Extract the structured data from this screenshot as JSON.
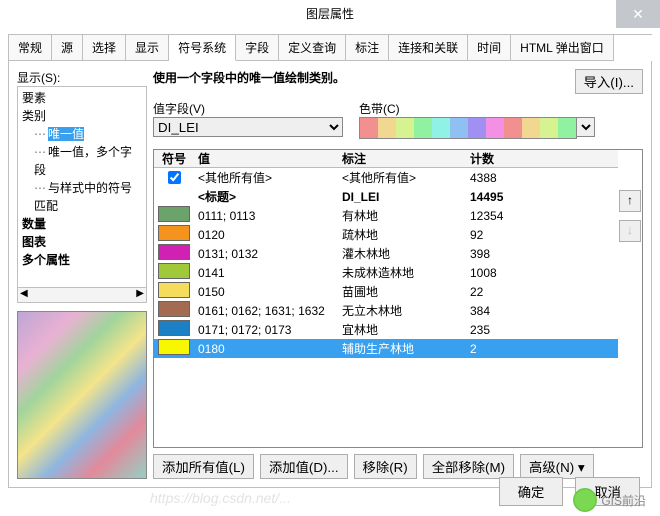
{
  "title": "图层属性",
  "tabs": [
    "常规",
    "源",
    "选择",
    "显示",
    "符号系统",
    "字段",
    "定义查询",
    "标注",
    "连接和关联",
    "时间",
    "HTML 弹出窗口"
  ],
  "active_tab": 4,
  "left": {
    "show_label": "显示(S):",
    "items": {
      "l0": "要素",
      "l1": "类别",
      "l2": "唯一值",
      "l3": "唯一值，多个字段",
      "l4": "与样式中的符号匹配",
      "l5": "数量",
      "l6": "图表",
      "l7": "多个属性"
    },
    "scroll_left": "◀",
    "scroll_right": "▶"
  },
  "right": {
    "desc": "使用一个字段中的唯一值绘制类别。",
    "import": "导入(I)...",
    "value_field_label": "值字段(V)",
    "value_field": "DI_LEI",
    "ramp_label": "色带(C)",
    "grid": {
      "h1": "符号",
      "h2": "值",
      "h3": "标注",
      "h4": "计数",
      "rows": [
        {
          "sym": "check",
          "v": "<其他所有值>",
          "l": "<其他所有值>",
          "c": "4388"
        },
        {
          "sym": "title",
          "v": "<标题>",
          "l": "DI_LEI",
          "c": "14495",
          "bold": true
        },
        {
          "sym": "#6ba36b",
          "v": "0111; 0113",
          "l": "有林地",
          "c": "12354"
        },
        {
          "sym": "#f4941e",
          "v": "0120",
          "l": "疏林地",
          "c": "92"
        },
        {
          "sym": "#d121b2",
          "v": "0131; 0132",
          "l": "灌木林地",
          "c": "398"
        },
        {
          "sym": "#a0c93a",
          "v": "0141",
          "l": "未成林造林地",
          "c": "1008"
        },
        {
          "sym": "#f5dc5d",
          "v": "0150",
          "l": "苗圃地",
          "c": "22"
        },
        {
          "sym": "#a36b52",
          "v": "0161; 0162; 1631; 1632",
          "l": "无立木林地",
          "c": "384"
        },
        {
          "sym": "#1b80c4",
          "v": "0171; 0172; 0173",
          "l": "宜林地",
          "c": "235"
        },
        {
          "sym": "#f7f700",
          "v": "0180",
          "l": "辅助生产林地",
          "c": "2",
          "sel": true
        }
      ]
    },
    "up": "↑",
    "down": "↓",
    "btns": {
      "add_all": "添加所有值(L)",
      "add": "添加值(D)...",
      "remove": "移除(R)",
      "remove_all": "全部移除(M)",
      "adv": "高级(N)"
    },
    "ramp_colors": [
      "#f29090",
      "#f2d790",
      "#d7f290",
      "#90f2a0",
      "#90f2e6",
      "#90c0f2",
      "#a090f2",
      "#f290e6",
      "#f29090",
      "#f2d790",
      "#d7f290",
      "#90f2a0"
    ]
  },
  "footer": {
    "ok": "确定",
    "cancel": "取消"
  },
  "watermark": "https://blog.csdn.net/...",
  "wechat": "GIS前沿"
}
